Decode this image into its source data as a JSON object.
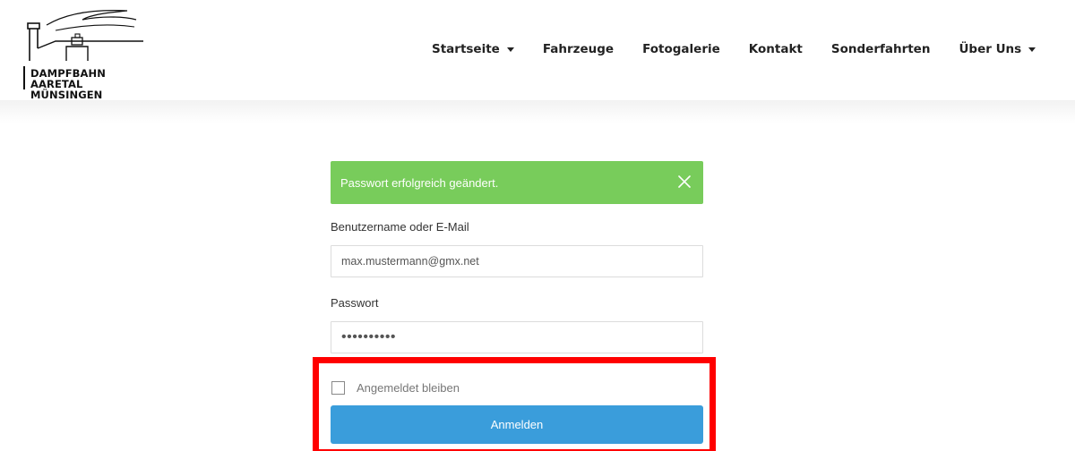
{
  "site": {
    "logo_line1": "DAMPFBAHN AARETAL",
    "logo_line2": "MÜNSINGEN"
  },
  "nav": {
    "items": [
      {
        "label": "Startseite",
        "dropdown": true
      },
      {
        "label": "Fahrzeuge",
        "dropdown": false
      },
      {
        "label": "Fotogalerie",
        "dropdown": false
      },
      {
        "label": "Kontakt",
        "dropdown": false
      },
      {
        "label": "Sonderfahrten",
        "dropdown": false
      },
      {
        "label": "Über Uns",
        "dropdown": true
      }
    ]
  },
  "alert": {
    "message": "Passwort erfolgreich geändert.",
    "close_icon": "close-icon",
    "color": "#78cc5b"
  },
  "form": {
    "username_label": "Benutzername oder E-Mail",
    "username_value": "max.mustermann@gmx.net",
    "password_label": "Passwort",
    "password_value": "••••••••••",
    "remember_label": "Angemeldet bleiben",
    "remember_checked": false,
    "submit_label": "Anmelden",
    "submit_color": "#3a9ddb"
  },
  "highlight": {
    "color": "#ff0000"
  }
}
